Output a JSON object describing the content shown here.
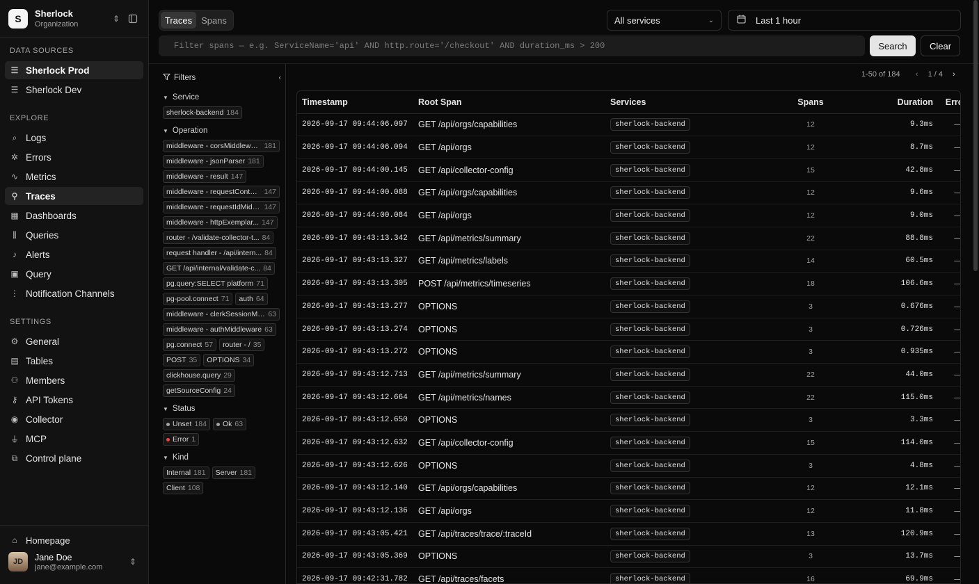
{
  "org": {
    "logo": "S",
    "name": "Sherlock",
    "subtitle": "Organization"
  },
  "sections": {
    "data_sources": "DATA SOURCES",
    "explore": "EXPLORE",
    "settings": "SETTINGS"
  },
  "data_sources": [
    {
      "label": "Sherlock Prod",
      "icon": "database-icon",
      "active": true
    },
    {
      "label": "Sherlock Dev",
      "icon": "database-icon",
      "active": false
    }
  ],
  "explore": [
    {
      "label": "Logs",
      "icon": "search-icon"
    },
    {
      "label": "Errors",
      "icon": "bug-icon"
    },
    {
      "label": "Metrics",
      "icon": "activity-icon"
    },
    {
      "label": "Traces",
      "icon": "traces-icon",
      "active": true
    },
    {
      "label": "Dashboards",
      "icon": "dashboard-icon"
    },
    {
      "label": "Queries",
      "icon": "library-icon"
    },
    {
      "label": "Alerts",
      "icon": "bell-icon"
    },
    {
      "label": "Query",
      "icon": "terminal-icon"
    },
    {
      "label": "Notification Channels",
      "icon": "channels-icon"
    }
  ],
  "settings": [
    {
      "label": "General",
      "icon": "gear-icon"
    },
    {
      "label": "Tables",
      "icon": "table-icon"
    },
    {
      "label": "Members",
      "icon": "users-icon"
    },
    {
      "label": "API Tokens",
      "icon": "key-icon"
    },
    {
      "label": "Collector",
      "icon": "radio-icon"
    },
    {
      "label": "MCP",
      "icon": "plug-icon"
    },
    {
      "label": "Control plane",
      "icon": "boxes-icon"
    }
  ],
  "footer": {
    "homepage": "Homepage",
    "user_name": "Jane Doe",
    "user_email": "jane@example.com",
    "avatar_initials": "JD"
  },
  "tabs": [
    "Traces",
    "Spans"
  ],
  "service_select": "All services",
  "time_range": "Last 1 hour",
  "search": {
    "placeholder": "Filter spans — e.g. ServiceName='api' AND http.route='/checkout' AND duration_ms > 200",
    "value": ""
  },
  "buttons": {
    "search": "Search",
    "clear": "Clear"
  },
  "pager": {
    "range": "1-50 of 184",
    "page": "1 / 4"
  },
  "filters": {
    "title": "Filters",
    "groups": [
      {
        "title": "Service",
        "items": [
          {
            "label": "sherlock-backend",
            "count": "184"
          }
        ]
      },
      {
        "title": "Operation",
        "items": [
          {
            "label": "middleware - corsMiddleware",
            "count": "181"
          },
          {
            "label": "middleware - jsonParser",
            "count": "181"
          },
          {
            "label": "middleware - result",
            "count": "147"
          },
          {
            "label": "middleware - requestContex...",
            "count": "147"
          },
          {
            "label": "middleware - requestIdMidd...",
            "count": "147"
          },
          {
            "label": "middleware - httpExemplar...",
            "count": "147"
          },
          {
            "label": "router - /validate-collector-t...",
            "count": "84"
          },
          {
            "label": "request handler - /api/intern...",
            "count": "84"
          },
          {
            "label": "GET /api/internal/validate-c...",
            "count": "84"
          },
          {
            "label": "pg.query:SELECT platform",
            "count": "71"
          },
          {
            "label": "pg-pool.connect",
            "count": "71"
          },
          {
            "label": "auth",
            "count": "64"
          },
          {
            "label": "middleware - clerkSessionMi...",
            "count": "63"
          },
          {
            "label": "middleware - authMiddleware",
            "count": "63"
          },
          {
            "label": "pg.connect",
            "count": "57"
          },
          {
            "label": "router - /",
            "count": "35"
          },
          {
            "label": "POST",
            "count": "35"
          },
          {
            "label": "OPTIONS",
            "count": "34"
          },
          {
            "label": "clickhouse.query",
            "count": "29"
          },
          {
            "label": "getSourceConfig",
            "count": "24"
          }
        ]
      },
      {
        "title": "Status",
        "items": [
          {
            "label": "Unset",
            "count": "184",
            "dot": "#a3a3a3"
          },
          {
            "label": "Ok",
            "count": "63",
            "dot": "#a3a3a3"
          },
          {
            "label": "Error",
            "count": "1",
            "dot": "#ef4444"
          }
        ]
      },
      {
        "title": "Kind",
        "items": [
          {
            "label": "Internal",
            "count": "181"
          },
          {
            "label": "Server",
            "count": "181"
          },
          {
            "label": "Client",
            "count": "108"
          }
        ]
      }
    ]
  },
  "table": {
    "columns": [
      "Timestamp",
      "Root Span",
      "Services",
      "Spans",
      "Duration",
      "Errors"
    ],
    "rows": [
      [
        "2026-09-17 09:44:06.097",
        "GET /api/orgs/capabilities",
        "sherlock-backend",
        "12",
        "9.3ms",
        "—"
      ],
      [
        "2026-09-17 09:44:06.094",
        "GET /api/orgs",
        "sherlock-backend",
        "12",
        "8.7ms",
        "—"
      ],
      [
        "2026-09-17 09:44:00.145",
        "GET /api/collector-config",
        "sherlock-backend",
        "15",
        "42.8ms",
        "—"
      ],
      [
        "2026-09-17 09:44:00.088",
        "GET /api/orgs/capabilities",
        "sherlock-backend",
        "12",
        "9.6ms",
        "—"
      ],
      [
        "2026-09-17 09:44:00.084",
        "GET /api/orgs",
        "sherlock-backend",
        "12",
        "9.0ms",
        "—"
      ],
      [
        "2026-09-17 09:43:13.342",
        "GET /api/metrics/summary",
        "sherlock-backend",
        "22",
        "88.8ms",
        "—"
      ],
      [
        "2026-09-17 09:43:13.327",
        "GET /api/metrics/labels",
        "sherlock-backend",
        "14",
        "60.5ms",
        "—"
      ],
      [
        "2026-09-17 09:43:13.305",
        "POST /api/metrics/timeseries",
        "sherlock-backend",
        "18",
        "106.6ms",
        "—"
      ],
      [
        "2026-09-17 09:43:13.277",
        "OPTIONS",
        "sherlock-backend",
        "3",
        "0.676ms",
        "—"
      ],
      [
        "2026-09-17 09:43:13.274",
        "OPTIONS",
        "sherlock-backend",
        "3",
        "0.726ms",
        "—"
      ],
      [
        "2026-09-17 09:43:13.272",
        "OPTIONS",
        "sherlock-backend",
        "3",
        "0.935ms",
        "—"
      ],
      [
        "2026-09-17 09:43:12.713",
        "GET /api/metrics/summary",
        "sherlock-backend",
        "22",
        "44.0ms",
        "—"
      ],
      [
        "2026-09-17 09:43:12.664",
        "GET /api/metrics/names",
        "sherlock-backend",
        "22",
        "115.0ms",
        "—"
      ],
      [
        "2026-09-17 09:43:12.650",
        "OPTIONS",
        "sherlock-backend",
        "3",
        "3.3ms",
        "—"
      ],
      [
        "2026-09-17 09:43:12.632",
        "GET /api/collector-config",
        "sherlock-backend",
        "15",
        "114.0ms",
        "—"
      ],
      [
        "2026-09-17 09:43:12.626",
        "OPTIONS",
        "sherlock-backend",
        "3",
        "4.8ms",
        "—"
      ],
      [
        "2026-09-17 09:43:12.140",
        "GET /api/orgs/capabilities",
        "sherlock-backend",
        "12",
        "12.1ms",
        "—"
      ],
      [
        "2026-09-17 09:43:12.136",
        "GET /api/orgs",
        "sherlock-backend",
        "12",
        "11.8ms",
        "—"
      ],
      [
        "2026-09-17 09:43:05.421",
        "GET /api/traces/trace/:traceId",
        "sherlock-backend",
        "13",
        "120.9ms",
        "—"
      ],
      [
        "2026-09-17 09:43:05.369",
        "OPTIONS",
        "sherlock-backend",
        "3",
        "13.7ms",
        "—"
      ],
      [
        "2026-09-17 09:42:31.782",
        "GET /api/traces/facets",
        "sherlock-backend",
        "16",
        "69.9ms",
        "—"
      ]
    ]
  }
}
